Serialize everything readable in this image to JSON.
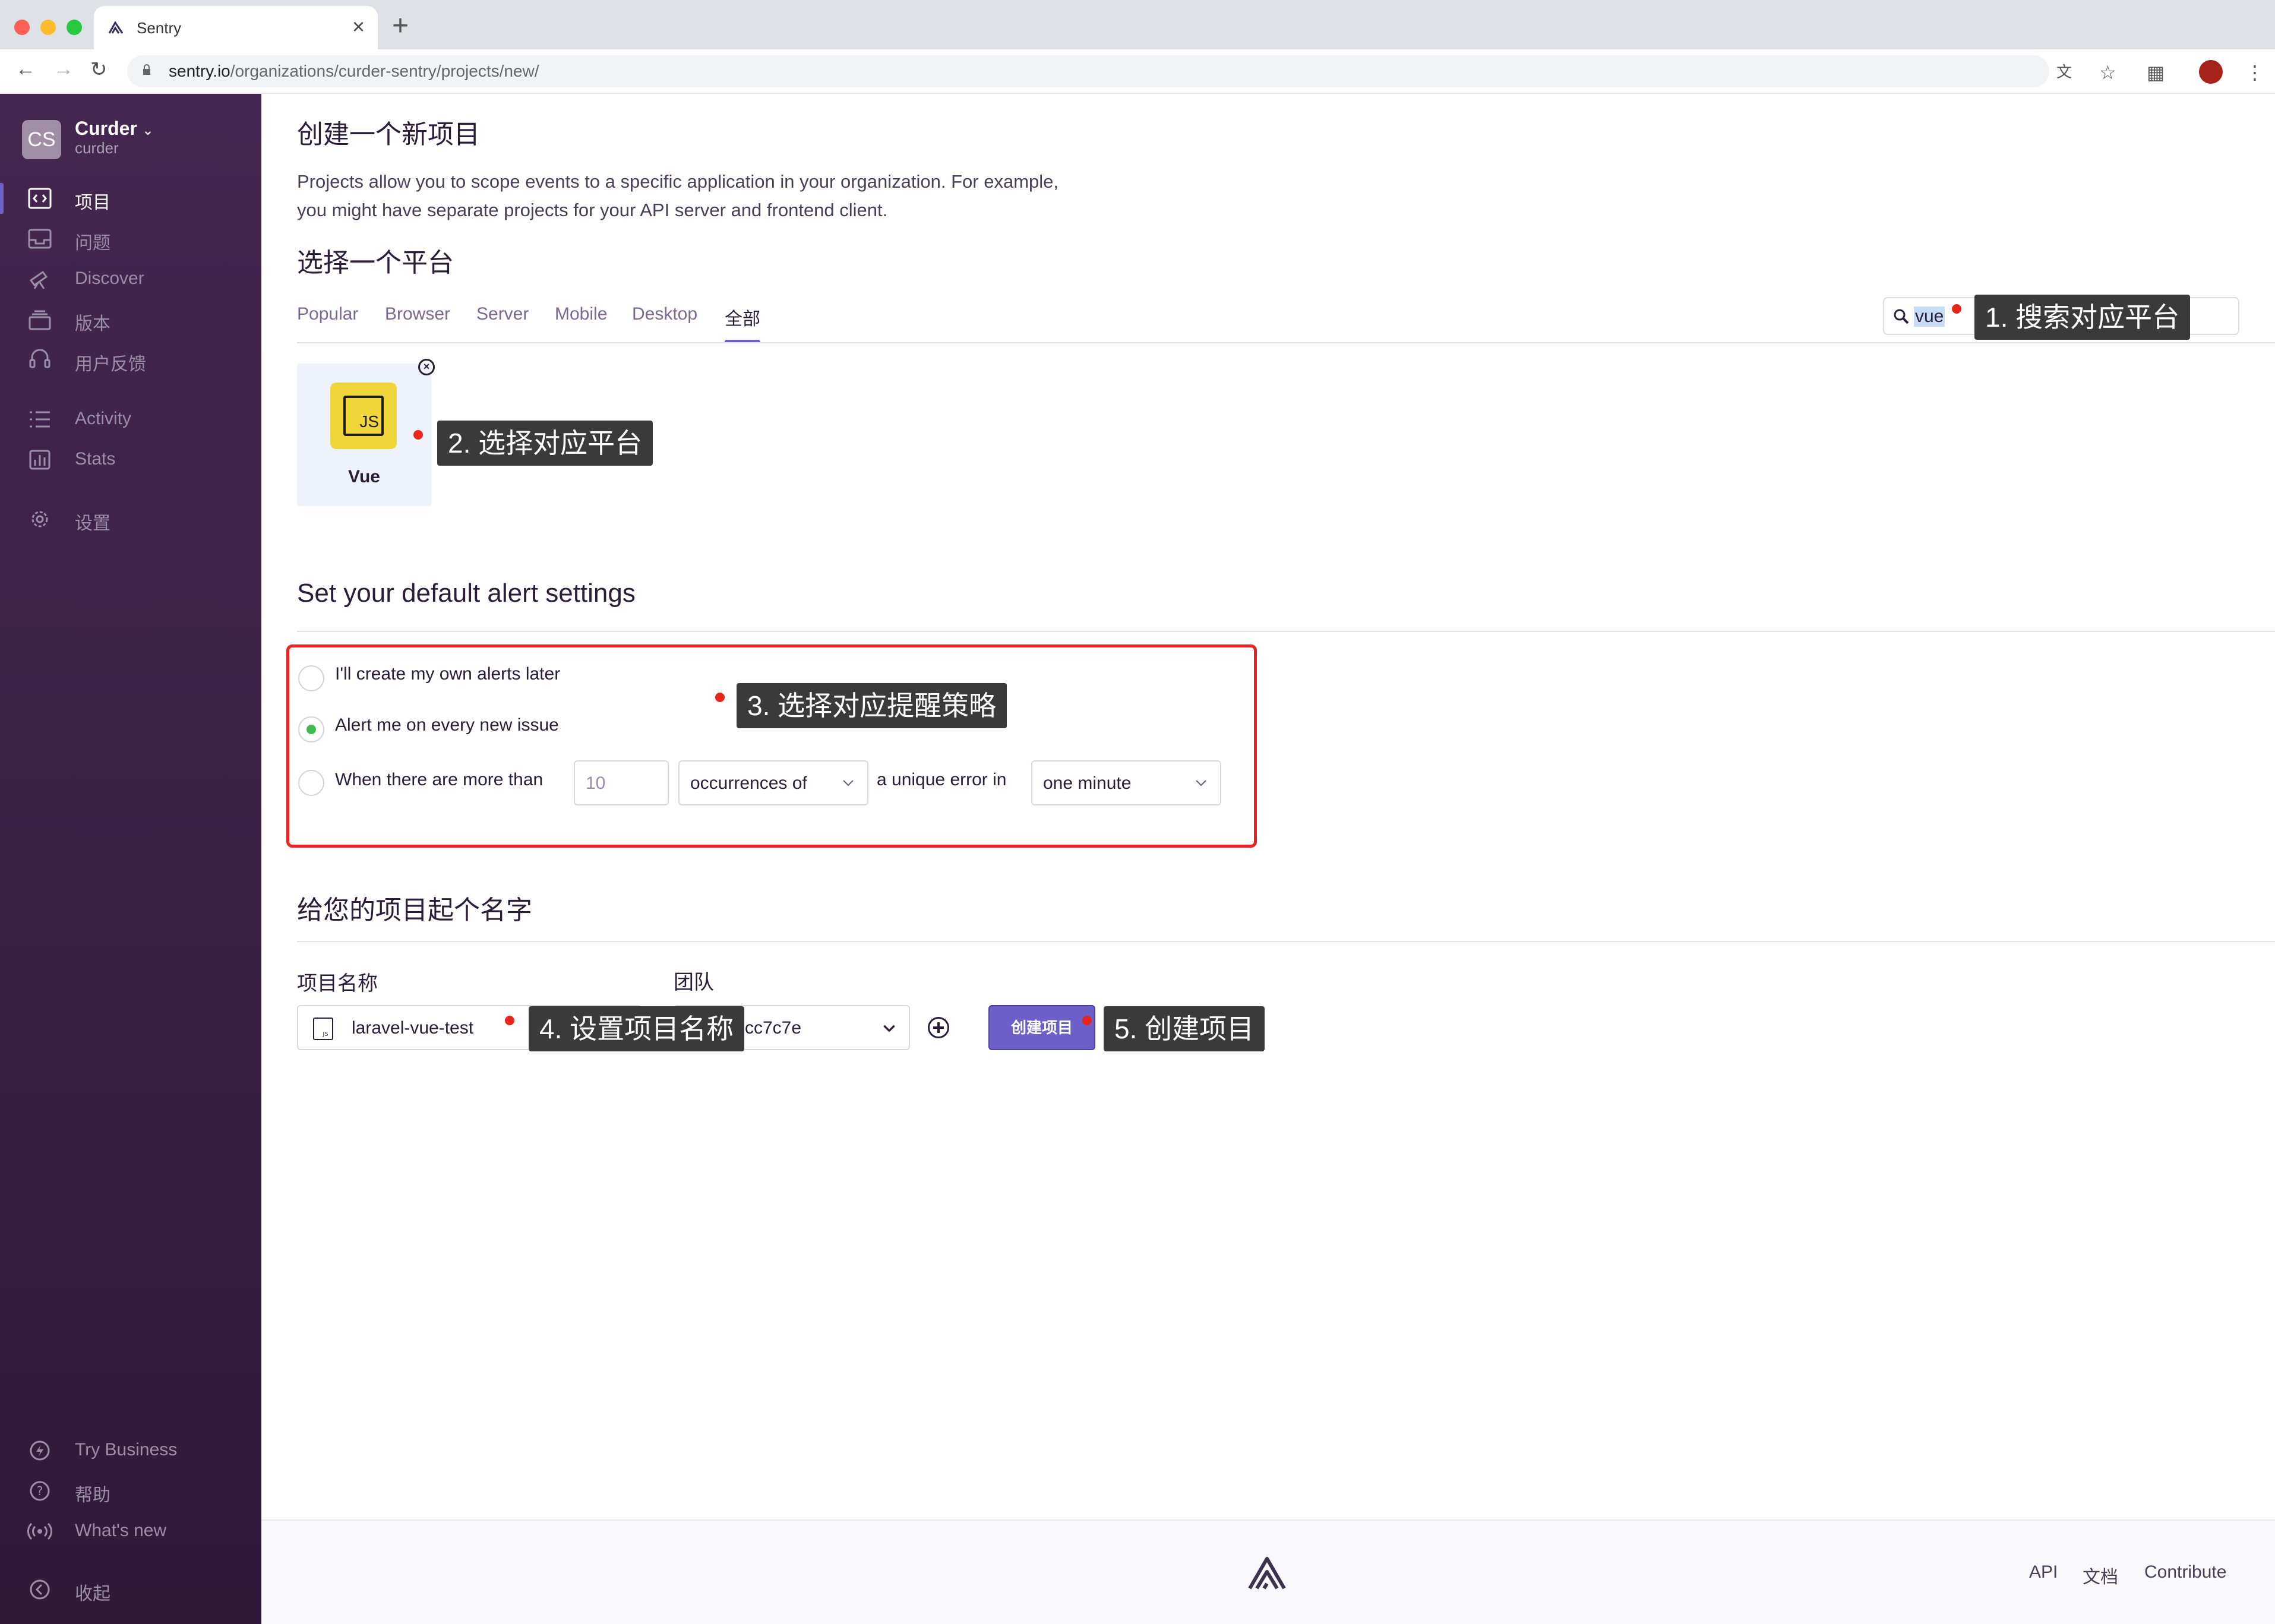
{
  "browser": {
    "tab_title": "Sentry",
    "url_host": "sentry.io",
    "url_path": "/organizations/curder-sentry/projects/new/"
  },
  "sidebar": {
    "org_initials": "CS",
    "org_name": "Curder",
    "org_slug": "curder",
    "items": [
      {
        "label": "项目",
        "icon": "code-icon"
      },
      {
        "label": "问题",
        "icon": "inbox-icon"
      },
      {
        "label": "Discover",
        "icon": "telescope-icon"
      },
      {
        "label": "版本",
        "icon": "stack-icon"
      },
      {
        "label": "用户反馈",
        "icon": "support-icon"
      },
      {
        "label": "Activity",
        "icon": "list-icon"
      },
      {
        "label": "Stats",
        "icon": "bar-chart-icon"
      },
      {
        "label": "设置",
        "icon": "gear-icon"
      }
    ],
    "bottom_items": [
      {
        "label": "Try Business",
        "icon": "lightning-icon"
      },
      {
        "label": "帮助",
        "icon": "question-icon"
      },
      {
        "label": "What's new",
        "icon": "broadcast-icon"
      },
      {
        "label": "收起",
        "icon": "collapse-icon"
      }
    ]
  },
  "main": {
    "title": "创建一个新项目",
    "description_line1": "Projects allow you to scope events to a specific application in your organization. For example,",
    "description_line2": "you might have separate projects for your API server and frontend client.",
    "platform_heading": "选择一个平台",
    "platform_tabs": [
      "Popular",
      "Browser",
      "Server",
      "Mobile",
      "Desktop",
      "全部"
    ],
    "search_value": "vue",
    "selected_platform": "Vue",
    "platform_logo_text": "JS",
    "alert_heading": "Set your default alert settings",
    "alert_options": {
      "own_later": "I'll create my own alerts later",
      "every_issue": "Alert me on every new issue",
      "more_than": "When there are more than",
      "threshold_placeholder": "10",
      "occurrences": "occurrences of",
      "unique_error_in": "a unique error in",
      "interval": "one minute"
    },
    "name_heading": "给您的项目起个名字",
    "project_name_label": "项目名称",
    "project_name_value": "laravel-vue-test",
    "team_label": "团队",
    "team_value": "#curder-bcc7c7e",
    "team_value_visible": "cc7c7e",
    "create_button": "创建项目"
  },
  "annotations": {
    "step1": "1. 搜索对应平台",
    "step2": "2. 选择对应平台",
    "step3": "3. 选择对应提醒策略",
    "step4": "4. 设置项目名称",
    "step5": "5. 创建项目"
  },
  "footer": {
    "links": [
      "API",
      "文档",
      "Contribute"
    ]
  },
  "colors": {
    "sidebar_top": "#452650",
    "sidebar_bottom": "#2f1a3a",
    "accent": "#6c5fc7",
    "annotation_box": "#e22222",
    "radio_selected": "#3fb950"
  }
}
